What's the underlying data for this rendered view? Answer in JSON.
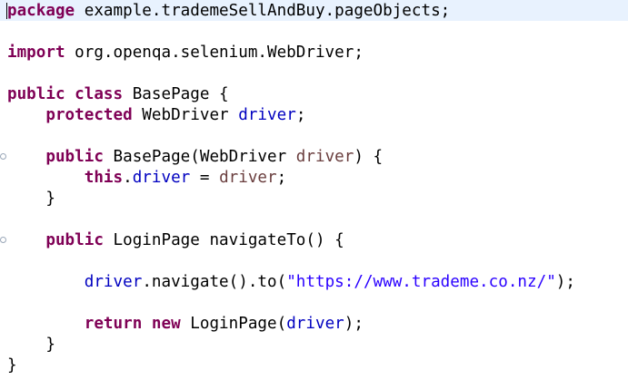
{
  "editor": {
    "language": "java",
    "colors": {
      "keyword": "#7f0055",
      "field": "#0000c0",
      "local_variable": "#6a3e3e",
      "string": "#2a00ff",
      "plain": "#000000",
      "current_line_highlight": "#e8f2fe"
    },
    "lines": [
      {
        "tokens": [
          {
            "t": "package",
            "c": "kw"
          },
          {
            "t": " example.trademeSellAndBuy.pageObjects;",
            "c": "txt"
          }
        ]
      },
      {
        "tokens": []
      },
      {
        "tokens": [
          {
            "t": "import",
            "c": "kw"
          },
          {
            "t": " org.openqa.selenium.WebDriver;",
            "c": "txt"
          }
        ]
      },
      {
        "tokens": []
      },
      {
        "tokens": [
          {
            "t": "public",
            "c": "kw"
          },
          {
            "t": " ",
            "c": "txt"
          },
          {
            "t": "class",
            "c": "kw"
          },
          {
            "t": " BasePage {",
            "c": "txt"
          }
        ]
      },
      {
        "tokens": [
          {
            "t": "    ",
            "c": "txt"
          },
          {
            "t": "protected",
            "c": "kw"
          },
          {
            "t": " WebDriver ",
            "c": "txt"
          },
          {
            "t": "driver",
            "c": "fld"
          },
          {
            "t": ";",
            "c": "txt"
          }
        ]
      },
      {
        "tokens": []
      },
      {
        "tokens": [
          {
            "t": "    ",
            "c": "txt"
          },
          {
            "t": "public",
            "c": "kw"
          },
          {
            "t": " BasePage(WebDriver ",
            "c": "txt"
          },
          {
            "t": "driver",
            "c": "var"
          },
          {
            "t": ") {",
            "c": "txt"
          }
        ]
      },
      {
        "tokens": [
          {
            "t": "        ",
            "c": "txt"
          },
          {
            "t": "this",
            "c": "kw"
          },
          {
            "t": ".",
            "c": "txt"
          },
          {
            "t": "driver",
            "c": "fld"
          },
          {
            "t": " = ",
            "c": "txt"
          },
          {
            "t": "driver",
            "c": "var"
          },
          {
            "t": ";",
            "c": "txt"
          }
        ]
      },
      {
        "tokens": [
          {
            "t": "    }",
            "c": "txt"
          }
        ]
      },
      {
        "tokens": []
      },
      {
        "tokens": [
          {
            "t": "    ",
            "c": "txt"
          },
          {
            "t": "public",
            "c": "kw"
          },
          {
            "t": " LoginPage navigateTo() {",
            "c": "txt"
          }
        ]
      },
      {
        "tokens": []
      },
      {
        "tokens": [
          {
            "t": "        ",
            "c": "txt"
          },
          {
            "t": "driver",
            "c": "fld"
          },
          {
            "t": ".navigate().to(",
            "c": "txt"
          },
          {
            "t": "\"https://www.trademe.co.nz/\"",
            "c": "str"
          },
          {
            "t": ");",
            "c": "txt"
          }
        ]
      },
      {
        "tokens": []
      },
      {
        "tokens": [
          {
            "t": "        ",
            "c": "txt"
          },
          {
            "t": "return",
            "c": "kw"
          },
          {
            "t": " ",
            "c": "txt"
          },
          {
            "t": "new",
            "c": "kw"
          },
          {
            "t": " LoginPage(",
            "c": "txt"
          },
          {
            "t": "driver",
            "c": "fld"
          },
          {
            "t": ");",
            "c": "txt"
          }
        ]
      },
      {
        "tokens": [
          {
            "t": "    }",
            "c": "txt"
          }
        ]
      },
      {
        "tokens": [
          {
            "t": "}",
            "c": "txt"
          }
        ]
      }
    ]
  }
}
